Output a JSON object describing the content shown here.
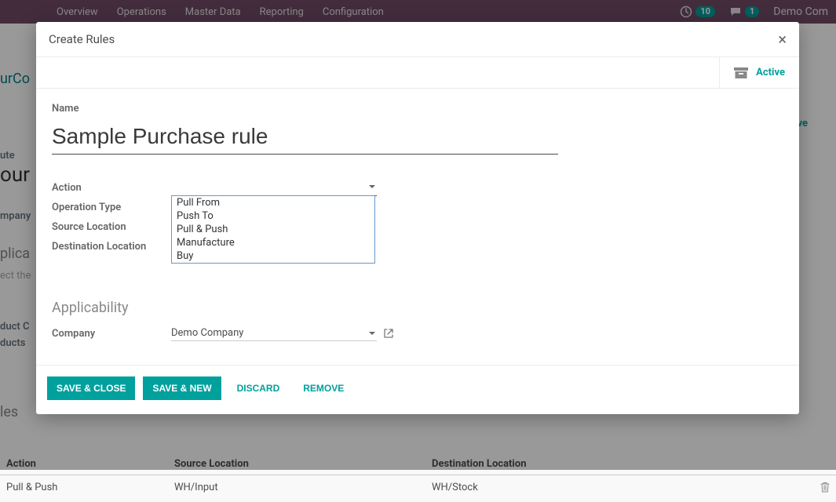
{
  "topbar": {
    "menu": [
      "Overview",
      "Operations",
      "Master Data",
      "Reporting",
      "Configuration"
    ],
    "clock_count": "10",
    "chat_count": "1",
    "company": "Demo Com"
  },
  "bg": {
    "crumb": "urCo",
    "ute": "ute",
    "our": "our",
    "mpany": "mpany",
    "plica": "plica",
    "ect": "ect the",
    "duct_c": "duct C",
    "ducts": "ducts",
    "les": "les",
    "ve": "ve",
    "table": {
      "h1": "Action",
      "h2": "Source Location",
      "h3": "Destination Location",
      "r1c1": "Pull & Push",
      "r1c2": "WH/Input",
      "r1c3": "WH/Stock"
    }
  },
  "modal": {
    "title": "Create Rules",
    "active_label": "Active",
    "name_label": "Name",
    "name_value": "Sample Purchase rule",
    "labels": {
      "action": "Action",
      "op_type": "Operation Type",
      "src": "Source Location",
      "dst": "Destination Location"
    },
    "action_options": [
      "Pull From",
      "Push To",
      "Pull & Push",
      "Manufacture",
      "Buy"
    ],
    "applicability_header": "Applicability",
    "company_label": "Company",
    "company_value": "Demo Company",
    "footer": {
      "save_close": "SAVE & CLOSE",
      "save_new": "SAVE & NEW",
      "discard": "DISCARD",
      "remove": "REMOVE"
    }
  }
}
